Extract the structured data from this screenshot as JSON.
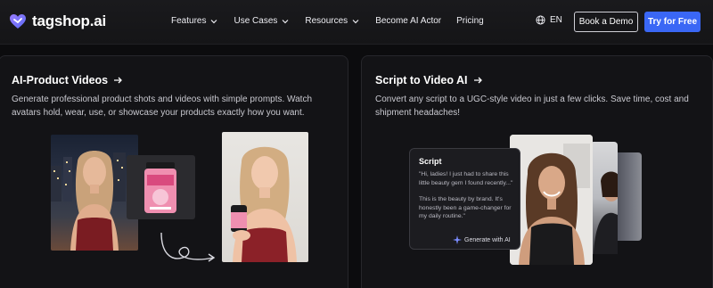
{
  "nav": {
    "logo_text": "tagshop.ai",
    "menu": [
      {
        "label": "Features",
        "has_dropdown": true
      },
      {
        "label": "Use Cases",
        "has_dropdown": true
      },
      {
        "label": "Resources",
        "has_dropdown": true
      },
      {
        "label": "Become AI Actor",
        "has_dropdown": false
      },
      {
        "label": "Pricing",
        "has_dropdown": false
      }
    ],
    "language": "EN",
    "demo_label": "Book a Demo",
    "try_label": "Try for Free"
  },
  "cards": {
    "left": {
      "title": "AI-Product Videos",
      "description": "Generate professional product shots and videos with simple prompts. Watch avatars hold, wear, use, or showcase your products exactly how you want."
    },
    "right": {
      "title": "Script to Video AI",
      "description": "Convert any script to a UGC-style video in just a few clicks. Save time, cost and shipment headaches!",
      "script": {
        "title": "Script",
        "text_1": "\"Hi, ladies! I just had to share this little beauty gem I found recently...\"",
        "text_2": "This is the beauty by brand. It's honestly been a game-changer for my daily routine.\"",
        "button_label": "Generate with AI"
      }
    }
  },
  "colors": {
    "accent": "#3a67f5",
    "background": "#0c0c0e",
    "card": "#131316",
    "logo": "#7c6cf6"
  },
  "icons": [
    "logo-heart-icon",
    "chevron-down-icon",
    "globe-icon",
    "arrow-right-icon",
    "sparkle-icon",
    "curved-arrow-icon"
  ]
}
